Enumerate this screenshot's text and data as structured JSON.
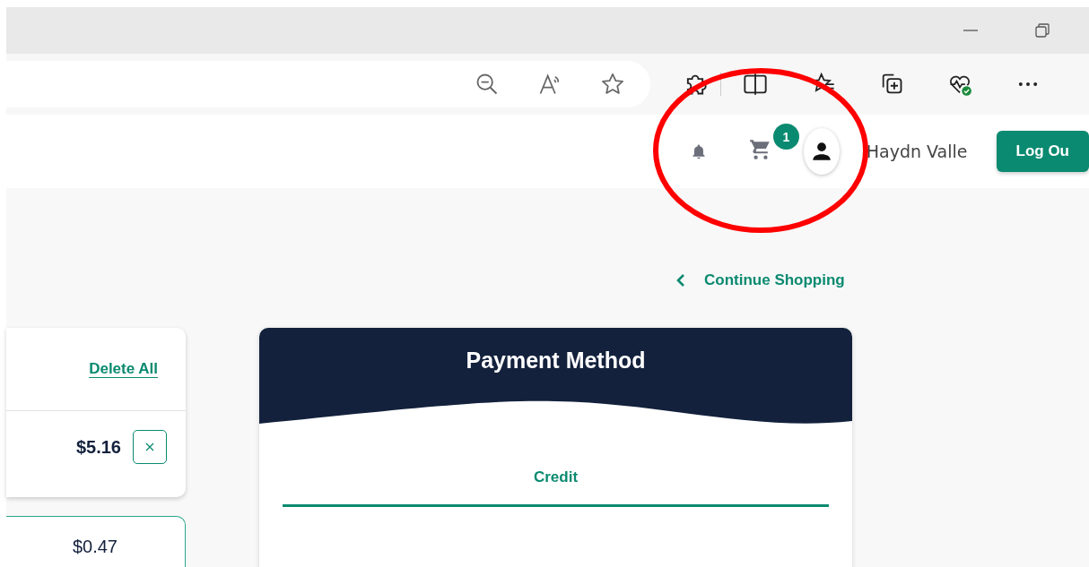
{
  "header": {
    "cart_count": "1",
    "user_name": "Haydn Valle",
    "logout_button": "Log Ou"
  },
  "continue_link": "Continue Shopping",
  "cart": {
    "delete_all": "Delete All",
    "items": [
      {
        "price": "$5.16"
      }
    ],
    "summary_value": "$0.47"
  },
  "payment": {
    "title": "Payment Method",
    "tabs": [
      {
        "label": "Credit",
        "selected": true
      }
    ]
  }
}
